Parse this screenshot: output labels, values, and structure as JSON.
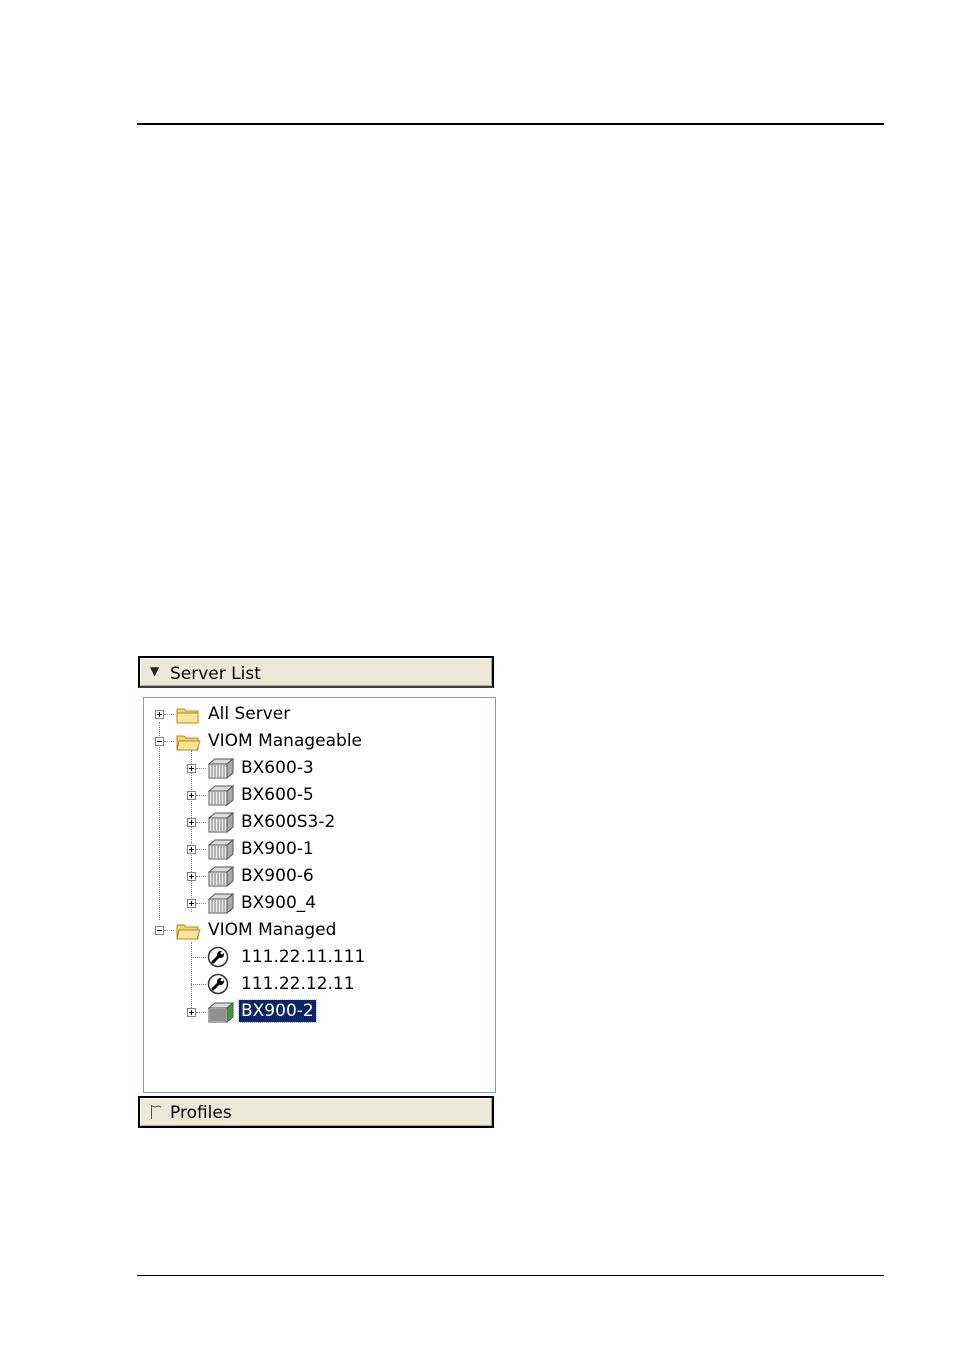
{
  "panel": {
    "header_title": "Server List",
    "footer_title": "Profiles",
    "header_icon": "triangle-down-icon",
    "footer_icon": "flag-icon"
  },
  "tree": {
    "all_server": "All Server",
    "viom_manageable": {
      "label": "VIOM Manageable",
      "children": [
        "BX600-3",
        "BX600-5",
        "BX600S3-2",
        "BX900-1",
        "BX900-6",
        "BX900_4"
      ]
    },
    "viom_managed": {
      "label": "VIOM Managed",
      "children": [
        "111.22.11.111",
        "111.22.12.11",
        "BX900-2"
      ]
    }
  },
  "selected_item": "BX900-2",
  "colors": {
    "selection": "#0a246a",
    "panel_bg": "#ece9d8",
    "tree_border": "#7f9db9",
    "folder": "#f5d26a"
  }
}
